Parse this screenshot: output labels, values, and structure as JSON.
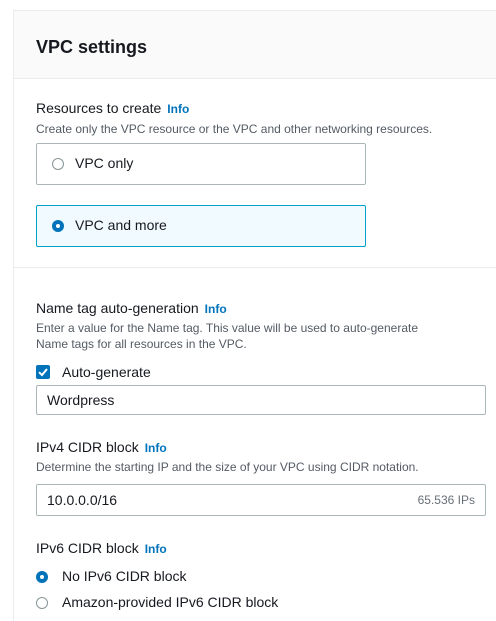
{
  "section_title": "VPC settings",
  "resources": {
    "label": "Resources to create",
    "info": "Info",
    "description": "Create only the VPC resource or the VPC and other networking resources.",
    "options": [
      {
        "label": "VPC only",
        "selected": false
      },
      {
        "label": "VPC and more",
        "selected": true
      }
    ]
  },
  "name_tag": {
    "label": "Name tag auto-generation",
    "info": "Info",
    "description_line1": "Enter a value for the Name tag. This value will be used to auto-generate",
    "description_line2": "Name tags for all resources in the VPC.",
    "checkbox_label": "Auto-generate",
    "checked": true,
    "value": "Wordpress"
  },
  "ipv4": {
    "label": "IPv4 CIDR block",
    "info": "Info",
    "description": "Determine the starting IP and the size of your VPC using CIDR notation.",
    "value": "10.0.0.0/16",
    "suffix": "65.536 IPs"
  },
  "ipv6": {
    "label": "IPv6 CIDR block",
    "info": "Info",
    "options": [
      {
        "label": "No IPv6 CIDR block",
        "selected": true
      },
      {
        "label": "Amazon-provided IPv6 CIDR block",
        "selected": false
      }
    ]
  },
  "colors": {
    "accent": "#0073bb",
    "selected_bg": "#f1faff",
    "selected_border": "#00a1c9"
  }
}
